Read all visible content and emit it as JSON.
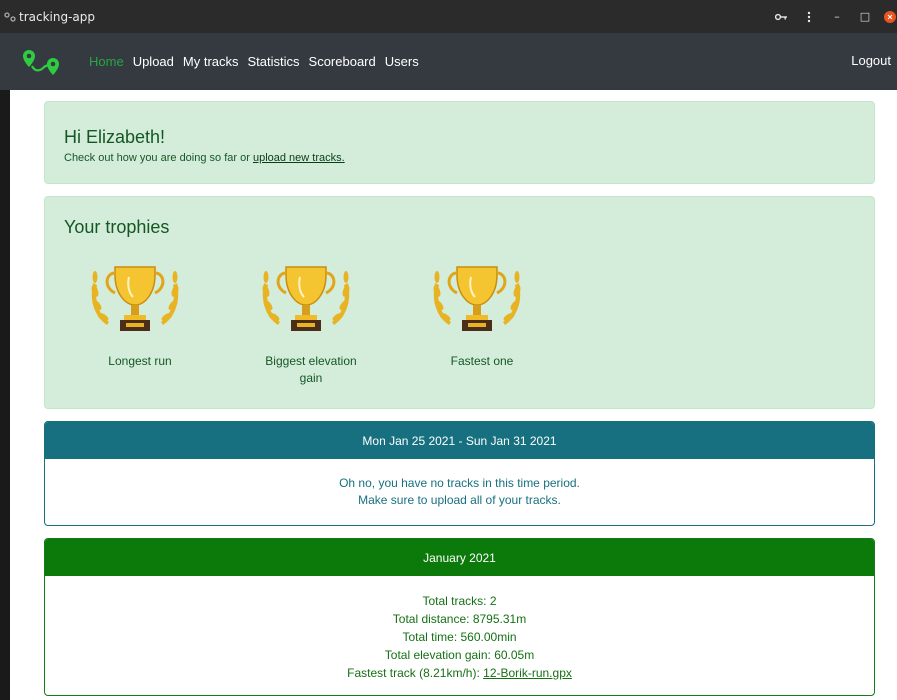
{
  "window": {
    "title": "tracking-app",
    "controls": {
      "key_icon": "key-icon",
      "menu_icon": "kebab-menu-icon",
      "minimize": "–",
      "maximize": "□",
      "close_icon": "close-icon"
    }
  },
  "navbar": {
    "logo_icon": "map-route-pins-icon",
    "links": [
      "Home",
      "Upload",
      "My tracks",
      "Statistics",
      "Scoreboard",
      "Users"
    ],
    "active_link": "Home",
    "logout": "Logout"
  },
  "greeting": {
    "heading": "Hi Elizabeth!",
    "text_before": "Check out how you are doing so far or ",
    "link": "upload new tracks."
  },
  "trophies": {
    "heading": "Your trophies",
    "items": [
      {
        "label": "Longest run",
        "icon": "trophy-icon"
      },
      {
        "label": "Biggest elevation gain",
        "icon": "trophy-icon"
      },
      {
        "label": "Fastest one",
        "icon": "trophy-icon"
      }
    ]
  },
  "week": {
    "header": "Mon Jan 25 2021 - Sun Jan 31 2021",
    "line1": "Oh no, you have no tracks in this time period.",
    "line2": "Make sure to upload all of your tracks."
  },
  "month": {
    "header": "January 2021",
    "total_tracks": "Total tracks: 2",
    "total_distance": "Total distance: 8795.31m",
    "total_time": "Total time: 560.00min",
    "total_elevation": "Total elevation gain: 60.05m",
    "fastest_prefix": "Fastest track (8.21km/h): ",
    "fastest_link": "12-Borik-run.gpx"
  },
  "colors": {
    "navbar_bg": "#343a40",
    "active_nav": "#28a745",
    "alert_green_bg": "#d4edda",
    "alert_green_text": "#155724",
    "week_header": "#17707f",
    "month_header": "#0b7a0b",
    "trophy_gold": "#f2b417"
  }
}
